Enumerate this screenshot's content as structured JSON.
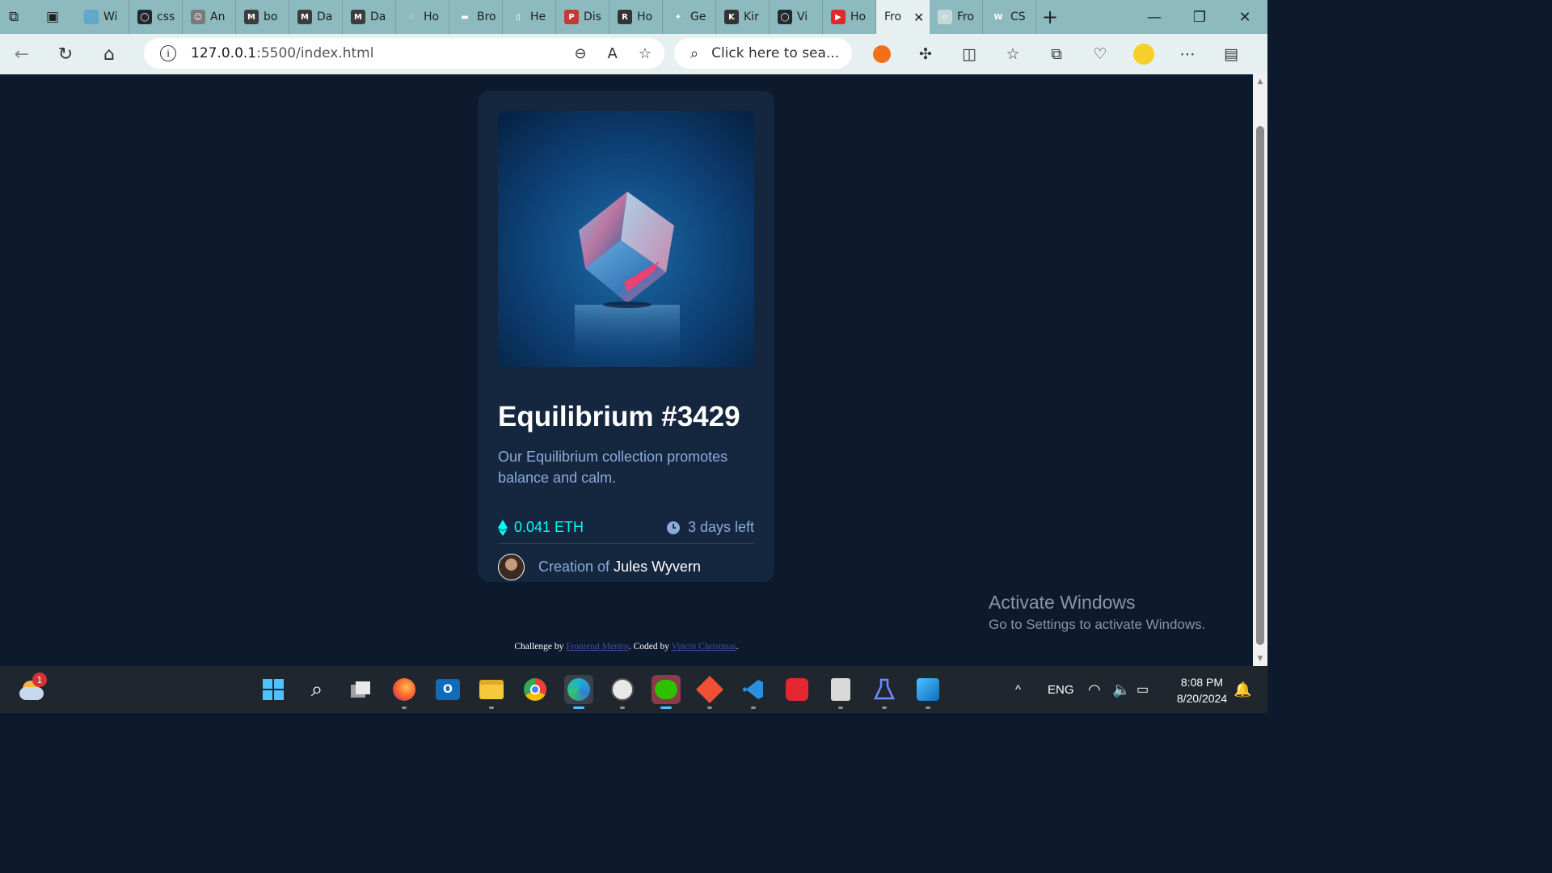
{
  "browser": {
    "tabs": [
      {
        "title": "Wi",
        "color": "#5fa8c8",
        "glyph": ""
      },
      {
        "title": "css",
        "color": "#24292f",
        "glyph": "◯"
      },
      {
        "title": "An",
        "color": "#7a7a7a",
        "glyph": "☺"
      },
      {
        "title": "bo",
        "color": "#3c3c3c",
        "glyph": "M"
      },
      {
        "title": "Da",
        "color": "#3c3c3c",
        "glyph": "M"
      },
      {
        "title": "Da",
        "color": "#3c3c3c",
        "glyph": "M"
      },
      {
        "title": "Ho",
        "color": "#8dbabe",
        "glyph": "♢"
      },
      {
        "title": "Bro",
        "color": "#8dbabe",
        "glyph": "▬"
      },
      {
        "title": "He",
        "color": "#8dbabe",
        "glyph": "▯"
      },
      {
        "title": "Dis",
        "color": "#c23b32",
        "glyph": "P"
      },
      {
        "title": "Ho",
        "color": "#333333",
        "glyph": "R"
      },
      {
        "title": "Ge",
        "color": "#8dbabe",
        "glyph": "✦"
      },
      {
        "title": "Kir",
        "color": "#333333",
        "glyph": "K"
      },
      {
        "title": "Vi",
        "color": "#24292f",
        "glyph": "◯"
      },
      {
        "title": "Ho",
        "color": "#e02a2a",
        "glyph": "▶"
      }
    ],
    "active_tab": {
      "title": "Fro"
    },
    "after_tabs": [
      {
        "title": "Fro",
        "color": "#c6d8da",
        "glyph": "▱"
      },
      {
        "title": "CS",
        "color": "#8dbabe",
        "glyph": "W"
      }
    ],
    "url_host": "127.0.0.1",
    "url_rest": ":5500/index.html",
    "search_placeholder": "Click here to sea..."
  },
  "card": {
    "title": "Equilibrium #3429",
    "description": "Our Equilibrium collection promotes balance and calm.",
    "price": "0.041 ETH",
    "time_left": "3 days left",
    "creator_prefix": "Creation of ",
    "creator_name": "Jules Wyvern"
  },
  "footer": {
    "prefix": "Challenge by ",
    "link1": "Frontend Mentor",
    "middle": ". Coded by ",
    "link2": "Vincin Christmas",
    "suffix": "."
  },
  "watermark": {
    "heading": "Activate Windows",
    "subtext": "Go to Settings to activate Windows."
  },
  "taskbar": {
    "weather_badge": "1",
    "lang": "ENG",
    "time": "8:08 PM",
    "date": "8/20/2024"
  },
  "colors": {
    "page_bg": "#0d192c",
    "card_bg": "#15263f",
    "cyan": "#00fff8",
    "soft_blue": "#8bacd9"
  }
}
